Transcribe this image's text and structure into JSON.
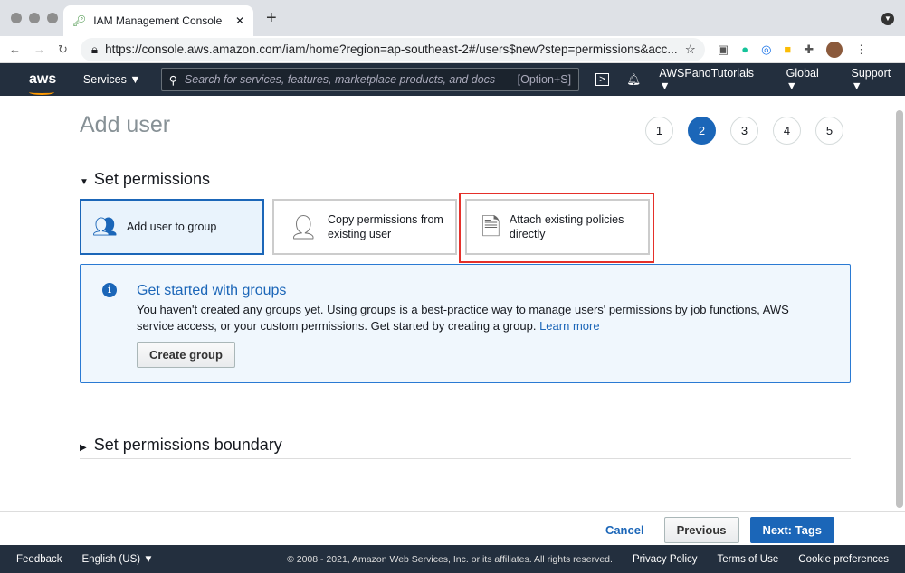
{
  "browser": {
    "tab_title": "IAM Management Console",
    "url": "https://console.aws.amazon.com/iam/home?region=ap-southeast-2#/users$new?step=permissions&acc..."
  },
  "nav": {
    "logo": "aws",
    "services": "Services ▼",
    "search_placeholder": "Search for services, features, marketplace products, and docs",
    "search_shortcut": "[Option+S]",
    "account": "AWSPanoTutorials ▼",
    "region": "Global ▼",
    "support": "Support ▼"
  },
  "page": {
    "title": "Add user",
    "steps": [
      "1",
      "2",
      "3",
      "4",
      "5"
    ],
    "active_step": "2"
  },
  "permissions": {
    "heading": "Set permissions",
    "options": [
      "Add user to group",
      "Copy permissions from existing user",
      "Attach existing policies directly"
    ]
  },
  "info": {
    "title": "Get started with groups",
    "text": "You haven't created any groups yet. Using groups is a best-practice way to manage users' permissions by job functions, AWS service access, or your custom permissions. Get started by creating a group. ",
    "link": "Learn more",
    "button": "Create group"
  },
  "boundary": {
    "heading": "Set permissions boundary"
  },
  "footer_actions": {
    "cancel": "Cancel",
    "previous": "Previous",
    "next": "Next: Tags"
  },
  "footer": {
    "feedback": "Feedback",
    "language": "English (US) ▼",
    "copyright": "© 2008 - 2021, Amazon Web Services, Inc. or its affiliates. All rights reserved.",
    "privacy": "Privacy Policy",
    "terms": "Terms of Use",
    "cookies": "Cookie preferences"
  }
}
